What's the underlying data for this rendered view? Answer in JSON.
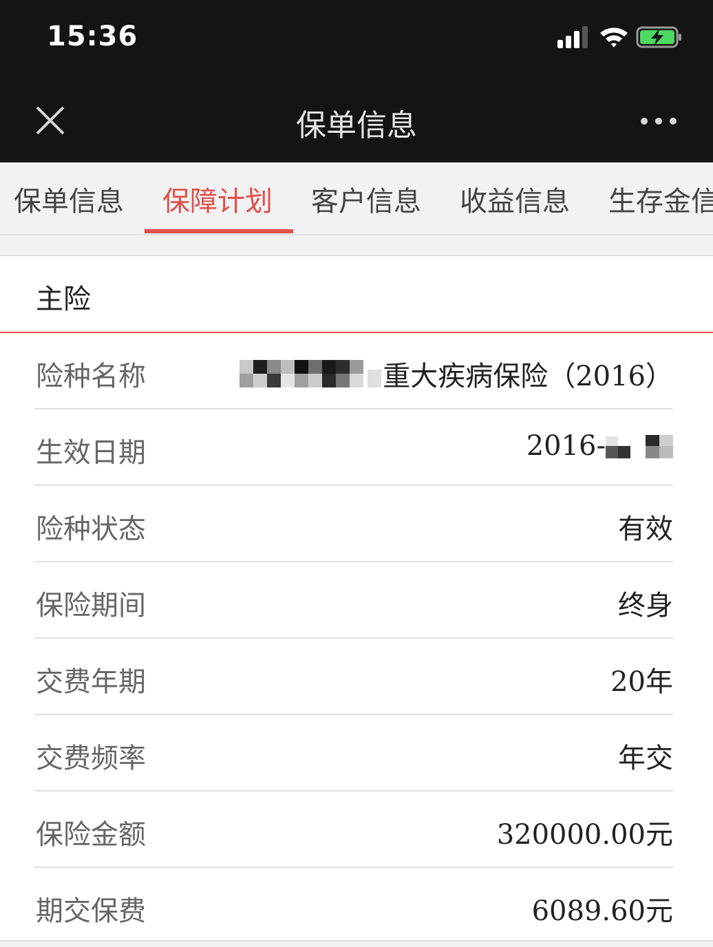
{
  "status_bar": {
    "time": "15:36",
    "icons": [
      "signal-icon",
      "wifi-icon",
      "battery-charging-icon"
    ]
  },
  "nav": {
    "title": "保单信息",
    "close_icon": "close-icon",
    "more_icon": "more-icon"
  },
  "tabs": [
    {
      "label": "保单信息",
      "active": false
    },
    {
      "label": "保障计划",
      "active": true
    },
    {
      "label": "客户信息",
      "active": false
    },
    {
      "label": "收益信息",
      "active": false
    },
    {
      "label": "生存金信",
      "active": false
    }
  ],
  "section": {
    "title": "主险"
  },
  "rows": [
    {
      "label": "险种名称",
      "value": "重大疾病保险（2016）"
    },
    {
      "label": "生效日期",
      "value": "2016-"
    },
    {
      "label": "险种状态",
      "value": "有效"
    },
    {
      "label": "保险期间",
      "value": "终身"
    },
    {
      "label": "交费年期",
      "value": "20年"
    },
    {
      "label": "交费频率",
      "value": "年交"
    },
    {
      "label": "保险金额",
      "value": "320000.00元"
    },
    {
      "label": "期交保费",
      "value": "6089.60元"
    }
  ],
  "colors": {
    "accent": "#e0504b",
    "header_bg": "#141414",
    "tab_bg": "#f2f2f2"
  }
}
